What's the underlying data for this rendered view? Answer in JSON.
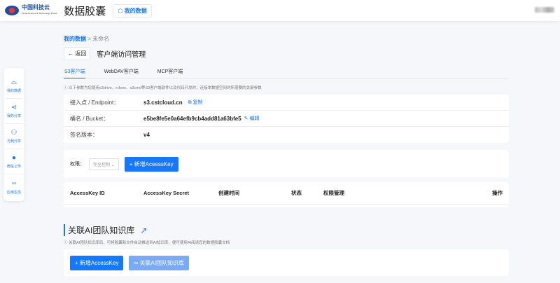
{
  "header": {
    "logo_text": "中国科技云",
    "logo_sub": "China Science & Technology Cloud",
    "app_title": "数据胶囊",
    "my_data_label": "我的数据"
  },
  "sidebar": {
    "items": [
      {
        "label": "我的数据",
        "icon": "drive-icon"
      },
      {
        "label": "我的分享",
        "icon": "share-icon"
      },
      {
        "label": "与我分享",
        "icon": "users-icon"
      },
      {
        "label": "微信上传",
        "icon": "wechat-icon"
      },
      {
        "label": "应用生态",
        "icon": "apps-icon"
      }
    ]
  },
  "breadcrumb": {
    "root": "我的数据",
    "sep": ">",
    "current": "未命名"
  },
  "back_label": "← 返回",
  "page_title": "客户端访问管理",
  "tabs": [
    {
      "label": "S3客户端",
      "active": true
    },
    {
      "label": "WebDAV客户端"
    },
    {
      "label": "MCP客户端"
    }
  ],
  "note": "ⓘ 以下参数为您使用s3drive、rclone、s3cmd等S3客户端软件以及代码开发时，连接本数据空间时所需要的关键参数",
  "params": [
    {
      "key": "接入点 / Endpoint：",
      "value": "s3.cstcloud.cn",
      "action": "复制"
    },
    {
      "key": "桶名 / Bucket：",
      "value": "e5be8fe5e0a64efb9cb4add81a63bfe5",
      "action": "编辑"
    },
    {
      "key": "签名版本：",
      "value": "v4"
    }
  ],
  "permission": {
    "label": "权限：",
    "selected": "完全控制",
    "add_button": "+ 新增AceessKey"
  },
  "table": {
    "columns": [
      "AccessKey ID",
      "AccessKey Secret",
      "创建时间",
      "状态",
      "权限管理",
      "操作"
    ],
    "rows": []
  },
  "ai_section": {
    "title": "关联AI团队知识库",
    "note": "ⓘ 关联AI团队知识库后，可将胶囊新文件自动推送到AI知识库，便可使用AI阅读您的数据胶囊文档",
    "add_button": "+ 新增AccessKey",
    "link_button": "∞ 关联AI团队知识库"
  },
  "colors": {
    "accent": "#1677ff",
    "background": "#f5f7fa"
  }
}
